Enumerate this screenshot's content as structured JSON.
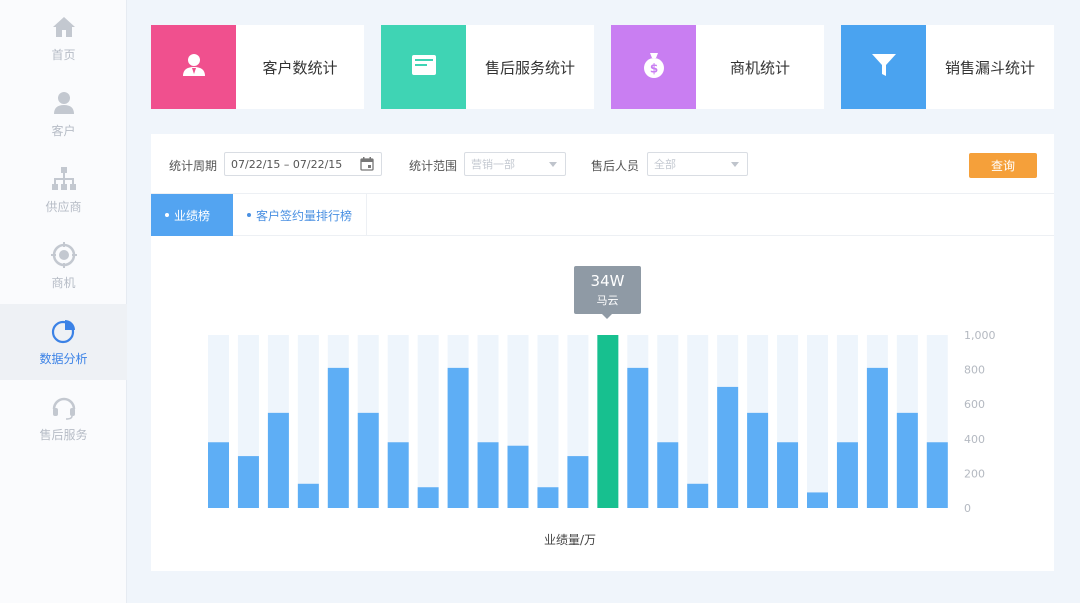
{
  "sidebar": {
    "items": [
      {
        "label": "首页",
        "icon": "home-icon",
        "active": false
      },
      {
        "label": "客户",
        "icon": "user-icon",
        "active": false
      },
      {
        "label": "供应商",
        "icon": "org-tree-icon",
        "active": false
      },
      {
        "label": "商机",
        "icon": "target-icon",
        "active": false
      },
      {
        "label": "数据分析",
        "icon": "pie-chart-icon",
        "active": true
      },
      {
        "label": "售后服务",
        "icon": "headset-icon",
        "active": false
      }
    ]
  },
  "cards": [
    {
      "label": "客户数统计",
      "color": "#f0508e",
      "icon": "customer-icon"
    },
    {
      "label": "售后服务统计",
      "color": "#3fd4b4",
      "icon": "document-icon"
    },
    {
      "label": "商机统计",
      "color": "#c97ef2",
      "icon": "money-bag-icon"
    },
    {
      "label": "销售漏斗统计",
      "color": "#4aa3f0",
      "icon": "funnel-icon"
    }
  ],
  "filters": {
    "period_label": "统计周期",
    "period_value": "07/22/15 – 07/22/15",
    "scope_label": "统计范围",
    "scope_value": "营销一部",
    "person_label": "售后人员",
    "person_value": "全部",
    "query_button": "查询"
  },
  "tabs": [
    {
      "label": "业绩榜",
      "active": true
    },
    {
      "label": "客户签约量排行榜",
      "active": false
    }
  ],
  "tooltip": {
    "value": "34W",
    "name": "马云"
  },
  "colors": {
    "bar": "#5eaef5",
    "highlight": "#17c08f",
    "track": "#eef5fc",
    "accent": "#f5a03a"
  },
  "chart_data": {
    "type": "bar",
    "xlabel": "业绩量/万",
    "ylabel": "",
    "ylim": [
      0,
      1000
    ],
    "yticks": [
      "1,000",
      "800",
      "600",
      "400",
      "200",
      "0"
    ],
    "values": [
      380,
      300,
      550,
      140,
      810,
      550,
      380,
      120,
      810,
      380,
      360,
      120,
      300,
      1000,
      810,
      380,
      140,
      700,
      550,
      380,
      90,
      380,
      810,
      550,
      380
    ],
    "highlight_index": 13
  }
}
